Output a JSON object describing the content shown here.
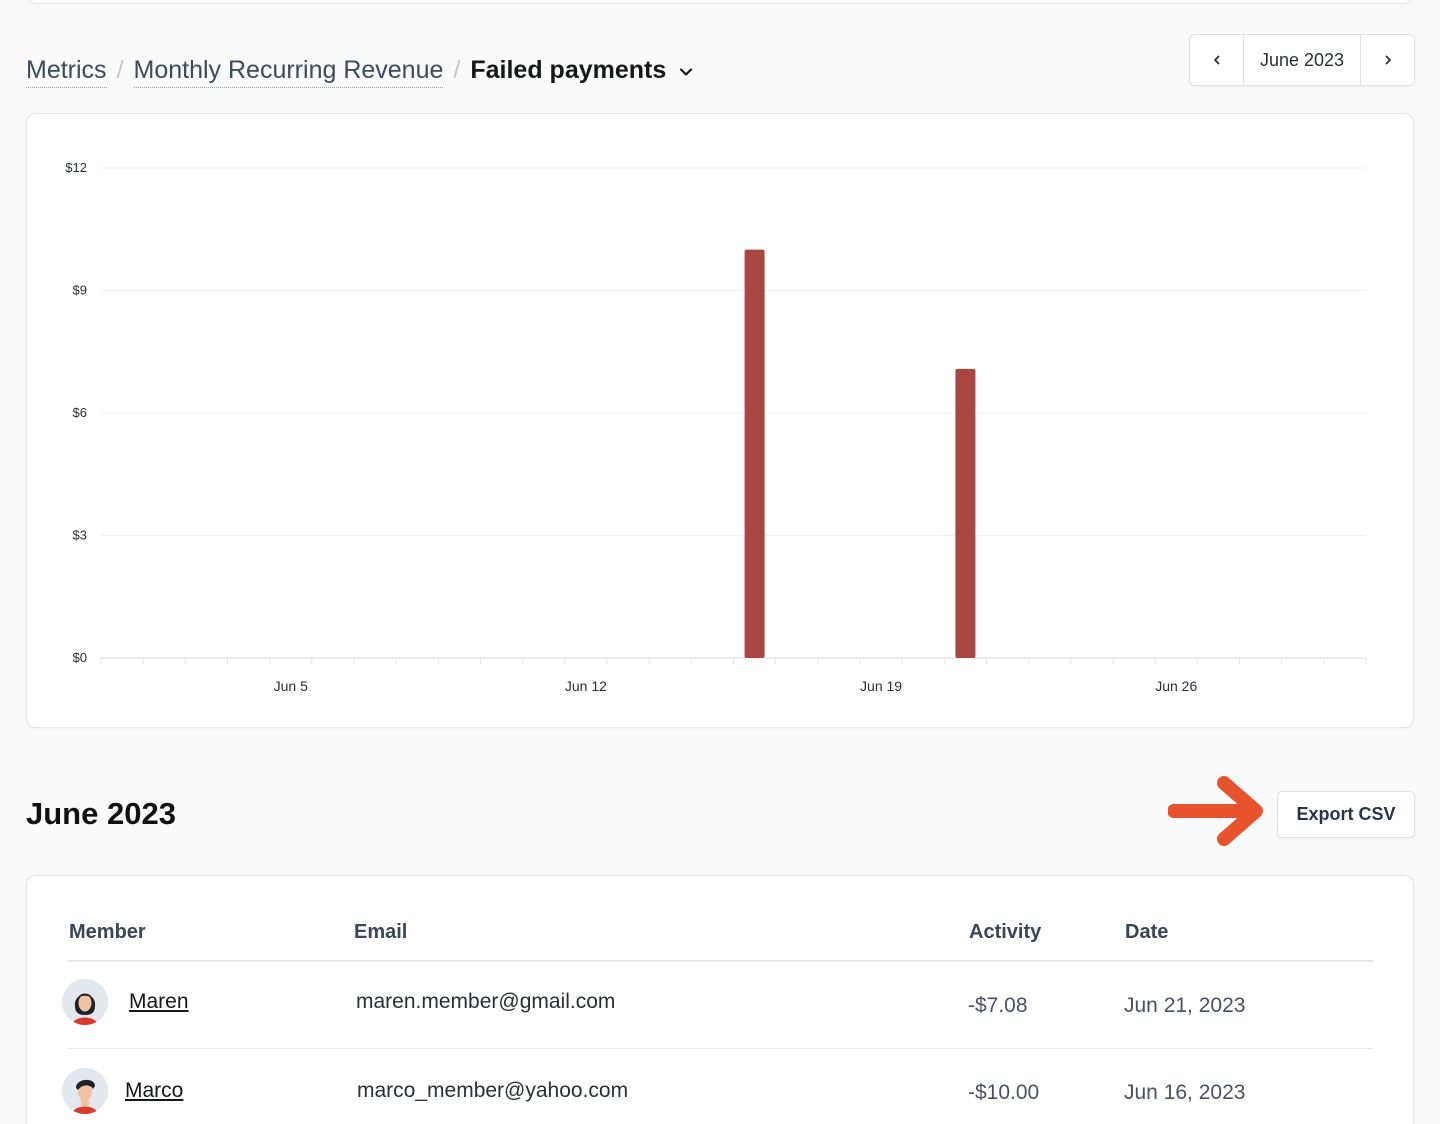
{
  "breadcrumb": {
    "items": [
      "Metrics",
      "Monthly Recurring Revenue"
    ],
    "separator": "/",
    "current": "Failed payments"
  },
  "month_nav": {
    "label": "June 2023",
    "prev_icon": "chevron-left-icon",
    "next_icon": "chevron-right-icon"
  },
  "chart_data": {
    "type": "bar",
    "y_ticks": [
      "$12",
      "$9",
      "$6",
      "$3",
      "$0"
    ],
    "ylim": [
      0,
      12
    ],
    "x_tick_labels": [
      {
        "label": "Jun 5",
        "day": 5
      },
      {
        "label": "Jun 12",
        "day": 12
      },
      {
        "label": "Jun 19",
        "day": 19
      },
      {
        "label": "Jun 26",
        "day": 26
      }
    ],
    "x_days": [
      1,
      30
    ],
    "bars": [
      {
        "day": 16,
        "value": 10.0
      },
      {
        "day": 21,
        "value": 7.08
      }
    ],
    "bar_color": "#a84641",
    "grid": true
  },
  "section": {
    "title": "June 2023",
    "export_label": "Export CSV",
    "arrow_color": "#e8532d"
  },
  "table": {
    "headers": {
      "member": "Member",
      "email": "Email",
      "activity": "Activity",
      "date": "Date"
    },
    "rows": [
      {
        "member": "Maren",
        "email": "maren.member@gmail.com",
        "activity": "-$7.08",
        "date": "Jun 21, 2023"
      },
      {
        "member": "Marco",
        "email": "marco_member@yahoo.com",
        "activity": "-$10.00",
        "date": "Jun 16, 2023"
      }
    ]
  }
}
